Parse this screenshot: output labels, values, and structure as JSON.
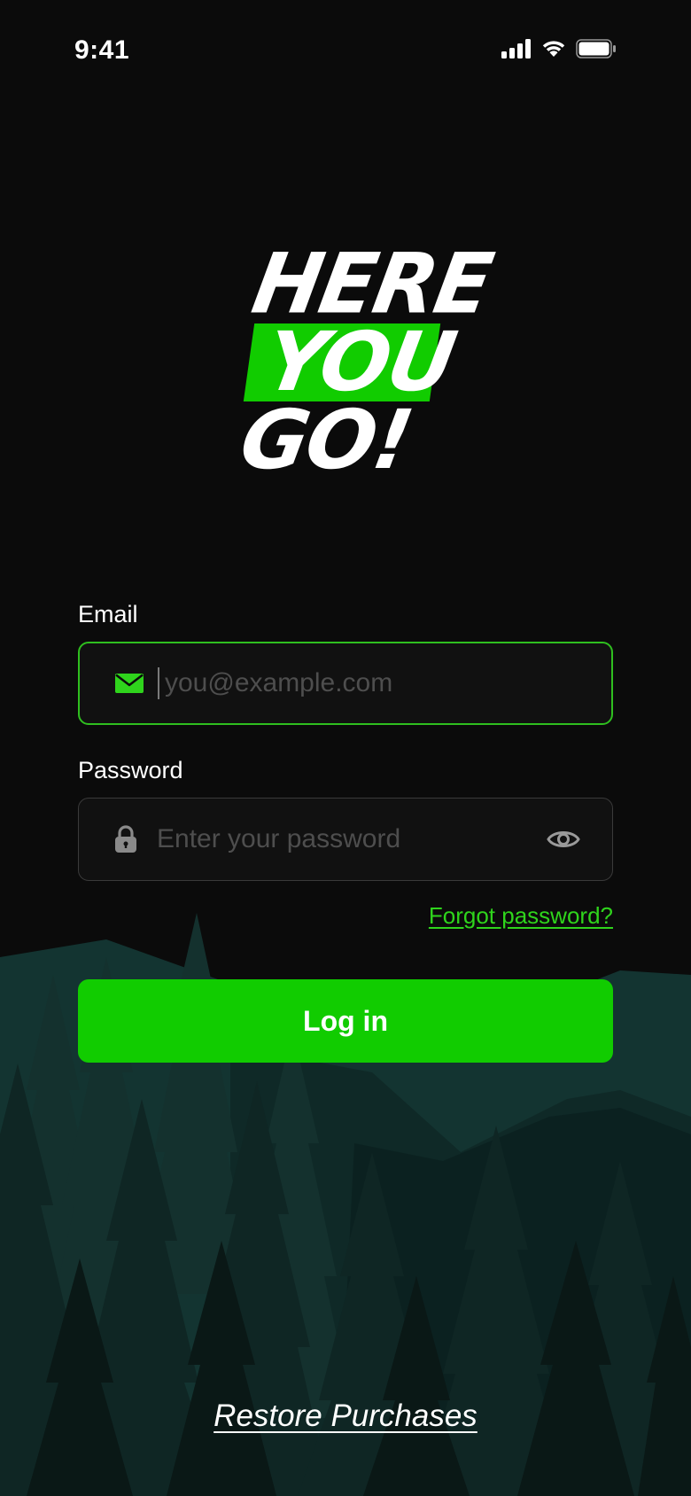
{
  "status_bar": {
    "time": "9:41",
    "icons": [
      "signal-icon",
      "wifi-icon",
      "battery-icon"
    ]
  },
  "logo": {
    "line1": "HERE",
    "line2": "YOU",
    "line3": "GO!",
    "accent": "#11cc00"
  },
  "form": {
    "email": {
      "label": "Email",
      "placeholder": "you@example.com",
      "value": "",
      "icon": "mail-icon"
    },
    "password": {
      "label": "Password",
      "placeholder": "Enter your password",
      "value": "",
      "icon": "lock-icon",
      "toggle_icon": "eye-icon"
    },
    "forgot_link": "Forgot password?",
    "login_label": "Log in"
  },
  "footer": {
    "restore_label": "Restore Purchases"
  },
  "colors": {
    "background": "#0b0b0b",
    "accent": "#11cc00",
    "forest_dark": "#0a1a18",
    "forest_mid": "#123431"
  }
}
